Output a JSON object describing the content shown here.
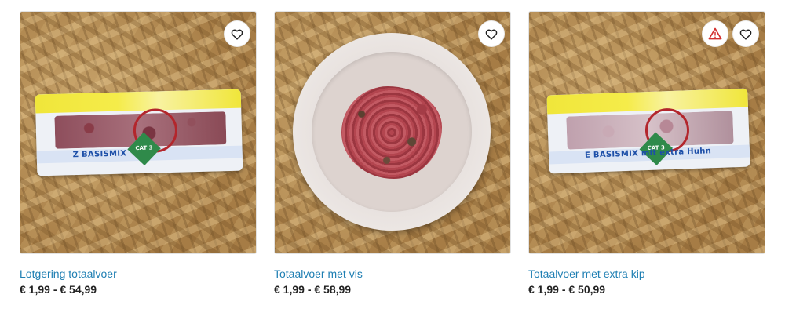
{
  "products": [
    {
      "title": "Lotgering totaalvoer",
      "price": "€ 1,99 - € 54,99",
      "pack_text": "Z BASISMIX",
      "cat_text": "CAT 3"
    },
    {
      "title": "Totaalvoer met vis",
      "price": "€ 1,99 - € 58,99"
    },
    {
      "title": "Totaalvoer met extra kip",
      "price": "€ 1,99 - € 50,99",
      "pack_text": "E BASISMIX mit extra Huhn",
      "cat_text": "CAT 3"
    }
  ],
  "colors": {
    "title_link": "#1f7fb3",
    "price": "#222222",
    "warning": "#d32f2f"
  },
  "icons": {
    "favorite": "heart-outline-icon",
    "warning": "warning-triangle-icon"
  }
}
